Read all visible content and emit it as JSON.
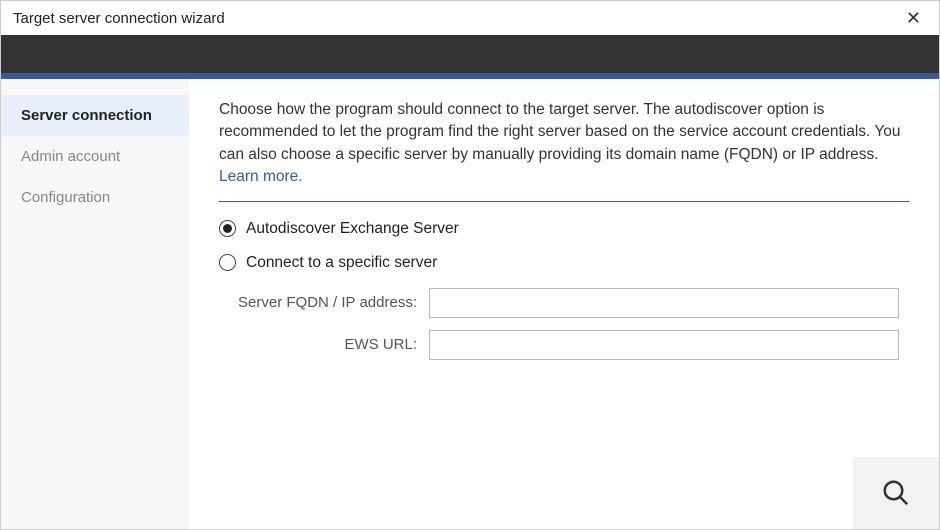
{
  "titlebar": {
    "title": "Target server connection wizard"
  },
  "sidebar": {
    "items": [
      {
        "label": "Server connection",
        "active": true
      },
      {
        "label": "Admin account",
        "active": false
      },
      {
        "label": "Configuration",
        "active": false
      }
    ]
  },
  "main": {
    "intro_text": "Choose how the program should connect to the target server. The autodiscover option is recommended to let the program find the right server based on the service account credentials. You can also choose a specific server by manually providing its domain name (FQDN) or IP address. ",
    "learn_more": "Learn more.",
    "options": {
      "autodiscover": {
        "label": "Autodiscover Exchange Server",
        "selected": true
      },
      "specific": {
        "label": "Connect to a specific server",
        "selected": false
      }
    },
    "fields": {
      "fqdn": {
        "label": "Server FQDN / IP address:",
        "value": ""
      },
      "ews": {
        "label": "EWS URL:",
        "value": ""
      }
    }
  }
}
